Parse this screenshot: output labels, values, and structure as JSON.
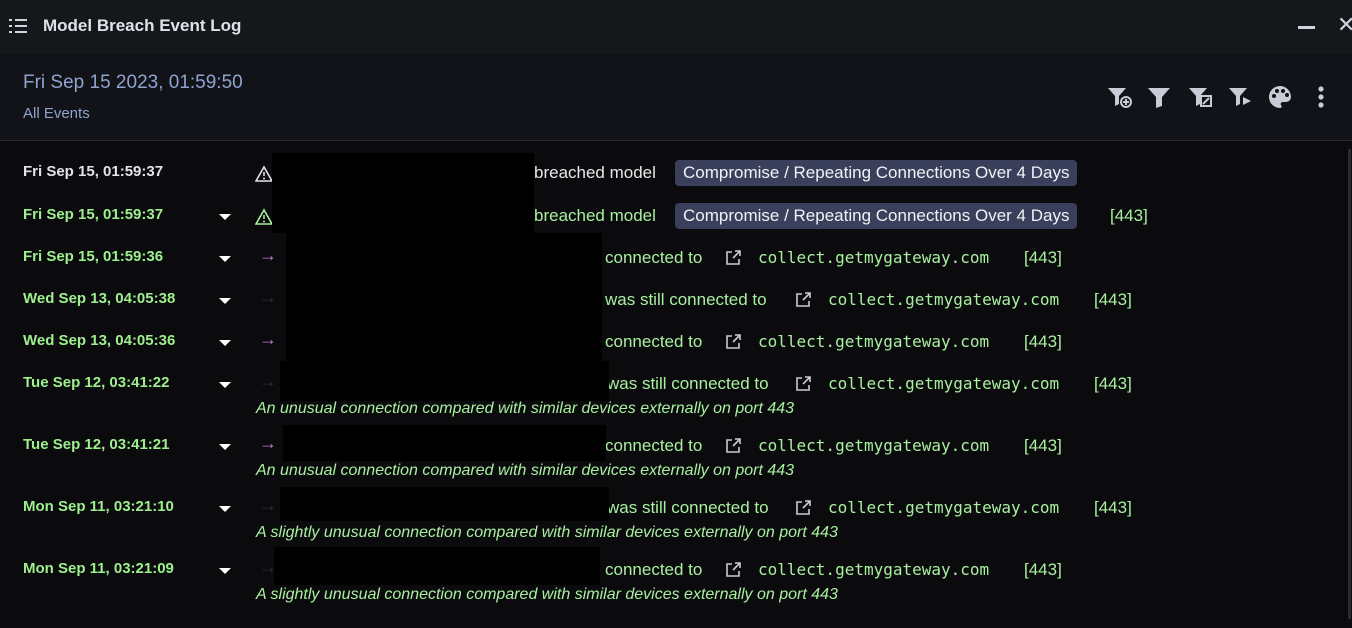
{
  "window": {
    "title": "Model Breach Event Log",
    "minimize": "—",
    "close": "✕"
  },
  "header": {
    "timestamp": "Fri Sep 15 2023, 01:59:50",
    "subtitle": "All Events"
  },
  "toolbar": {
    "icons": [
      "add-filter-icon",
      "filter-icon",
      "edit-filter-icon",
      "filter-actions-icon",
      "palette-icon",
      "more-vertical-icon"
    ]
  },
  "colors": {
    "accent_text": "#8fa3cf",
    "success_green": "#9ef08e",
    "badge_bg": "#3a3f5c",
    "arrow_purple": "#c97ac9"
  },
  "events": [
    {
      "ts": "Fri Sep 15, 01:59:37",
      "action": "breached model",
      "model": "Compromise / Repeating Connections Over 4 Days"
    },
    {
      "ts": "Fri Sep 15, 01:59:37",
      "action": "breached model",
      "model": "Compromise / Repeating Connections Over 4 Days",
      "port": "[443]"
    },
    {
      "ts": "Fri Sep 15, 01:59:36",
      "action": "connected to",
      "host": "collect.getmygateway.com",
      "port": "[443]"
    },
    {
      "ts": "Wed Sep 13, 04:05:38",
      "action": "was still connected to",
      "host": "collect.getmygateway.com",
      "port": "[443]"
    },
    {
      "ts": "Wed Sep 13, 04:05:36",
      "action": "connected to",
      "host": "collect.getmygateway.com",
      "port": "[443]"
    },
    {
      "ts": "Tue Sep 12, 03:41:22",
      "action": "was still connected to",
      "host": "collect.getmygateway.com",
      "port": "[443]",
      "note": "An unusual connection compared with similar devices externally on port 443"
    },
    {
      "ts": "Tue Sep 12, 03:41:21",
      "action": "connected to",
      "host": "collect.getmygateway.com",
      "port": "[443]",
      "note": "An unusual connection compared with similar devices externally on port 443"
    },
    {
      "ts": "Mon Sep 11, 03:21:10",
      "action": "was still connected to",
      "host": "collect.getmygateway.com",
      "port": "[443]",
      "note": "A slightly unusual connection compared with similar devices externally on port 443"
    },
    {
      "ts": "Mon Sep 11, 03:21:09",
      "action": "connected to",
      "host": "collect.getmygateway.com",
      "port": "[443]",
      "note": "A slightly unusual connection compared with similar devices externally on port 443"
    }
  ]
}
